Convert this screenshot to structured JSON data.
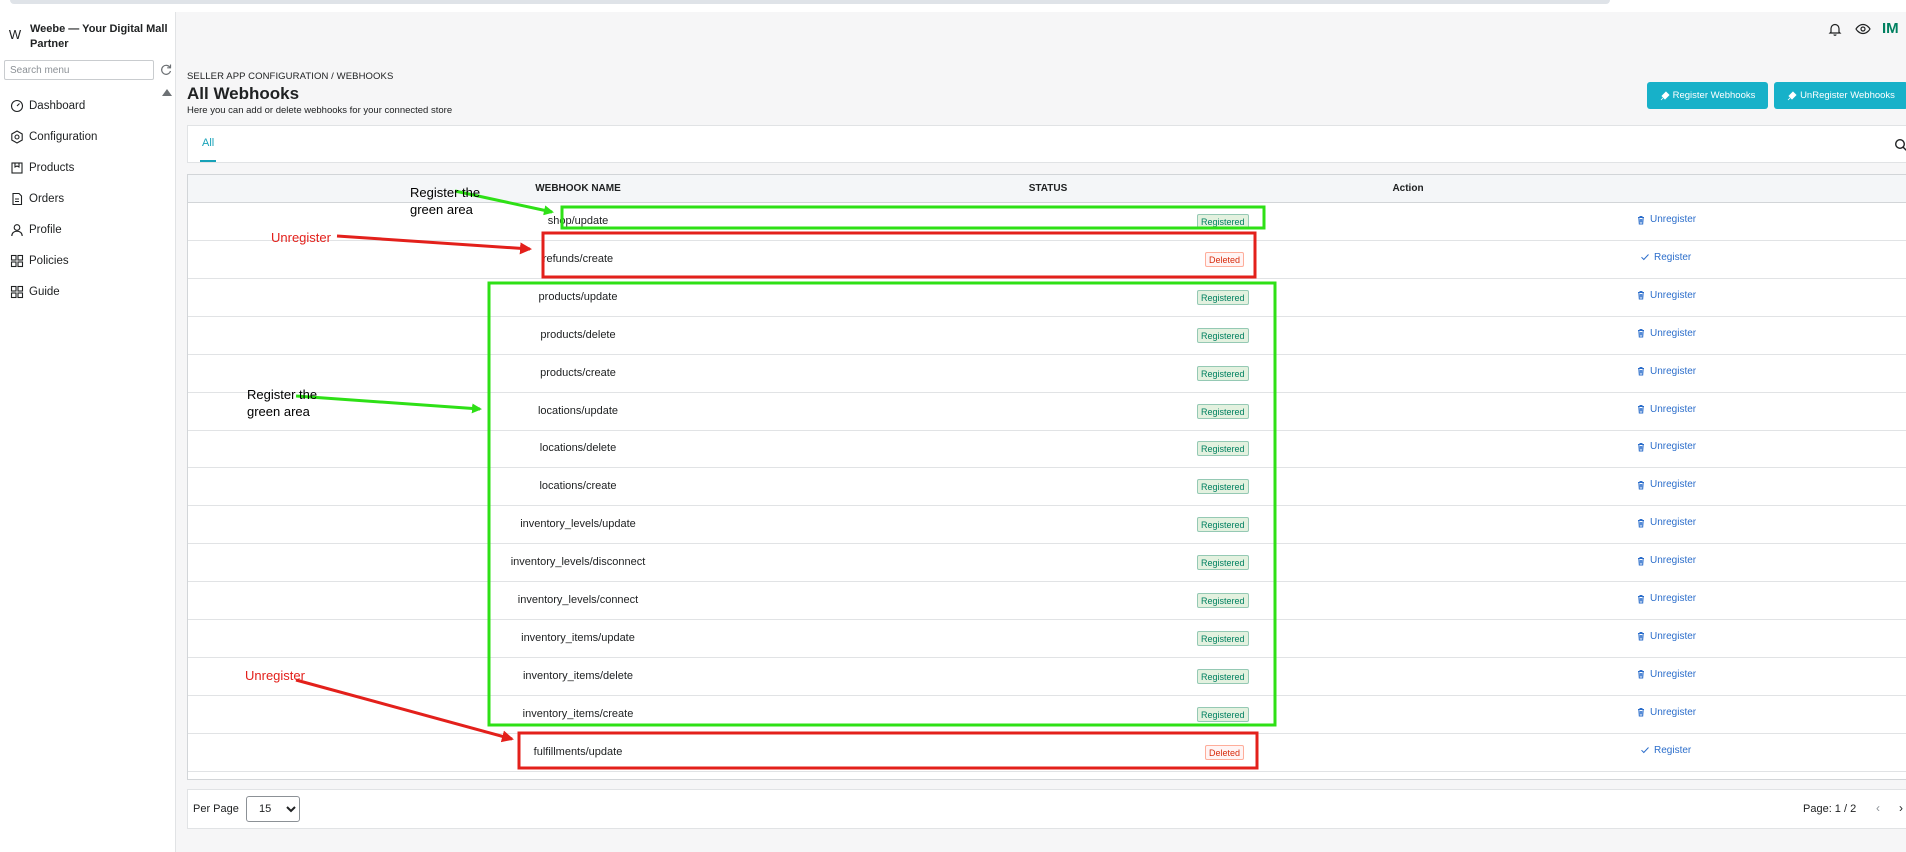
{
  "app": {
    "brand_initial": "W",
    "brand_name": "Weebe — Your Digital Mall Partner",
    "avatar_initials": "IM"
  },
  "sidebar": {
    "search_placeholder": "Search menu",
    "items": [
      {
        "label": "Dashboard",
        "icon": "dashboard-icon"
      },
      {
        "label": "Configuration",
        "icon": "settings-icon"
      },
      {
        "label": "Products",
        "icon": "products-icon"
      },
      {
        "label": "Orders",
        "icon": "orders-icon"
      },
      {
        "label": "Profile",
        "icon": "profile-icon"
      },
      {
        "label": "Policies",
        "icon": "policies-icon"
      },
      {
        "label": "Guide",
        "icon": "guide-icon"
      }
    ]
  },
  "header": {
    "breadcrumb": "SELLER APP CONFIGURATION / WEBHOOKS",
    "title": "All Webhooks",
    "subtitle": "Here you can add or delete webhooks for your connected store",
    "register_button": "Register Webhooks",
    "unregister_button": "UnRegister Webhooks"
  },
  "tabs": {
    "all": "All"
  },
  "table": {
    "headers": {
      "name": "WEBHOOK NAME",
      "status": "STATUS",
      "action": "Action"
    },
    "rows": [
      {
        "name": "shop/update",
        "status": "Registered",
        "action": "Unregister"
      },
      {
        "name": "refunds/create",
        "status": "Deleted",
        "action": "Register"
      },
      {
        "name": "products/update",
        "status": "Registered",
        "action": "Unregister"
      },
      {
        "name": "products/delete",
        "status": "Registered",
        "action": "Unregister"
      },
      {
        "name": "products/create",
        "status": "Registered",
        "action": "Unregister"
      },
      {
        "name": "locations/update",
        "status": "Registered",
        "action": "Unregister"
      },
      {
        "name": "locations/delete",
        "status": "Registered",
        "action": "Unregister"
      },
      {
        "name": "locations/create",
        "status": "Registered",
        "action": "Unregister"
      },
      {
        "name": "inventory_levels/update",
        "status": "Registered",
        "action": "Unregister"
      },
      {
        "name": "inventory_levels/disconnect",
        "status": "Registered",
        "action": "Unregister"
      },
      {
        "name": "inventory_levels/connect",
        "status": "Registered",
        "action": "Unregister"
      },
      {
        "name": "inventory_items/update",
        "status": "Registered",
        "action": "Unregister"
      },
      {
        "name": "inventory_items/delete",
        "status": "Registered",
        "action": "Unregister"
      },
      {
        "name": "inventory_items/create",
        "status": "Registered",
        "action": "Unregister"
      },
      {
        "name": "fulfillments/update",
        "status": "Deleted",
        "action": "Register"
      }
    ]
  },
  "footer": {
    "per_page_label": "Per Page",
    "per_page_value": "15",
    "page_info": "Page: 1 / 2"
  },
  "annotations": {
    "note_register_1": "Register the\ngreen area",
    "note_unregister_1": "Unregister",
    "note_register_2": "Register the\ngreen area",
    "note_unregister_2": "Unregister",
    "colors": {
      "green": "#2ee016",
      "red": "#e3201b"
    }
  },
  "colors": {
    "accent": "#17b1c9",
    "registered": "#008060",
    "deleted": "#d72c0d",
    "link": "#2c6ecb"
  }
}
